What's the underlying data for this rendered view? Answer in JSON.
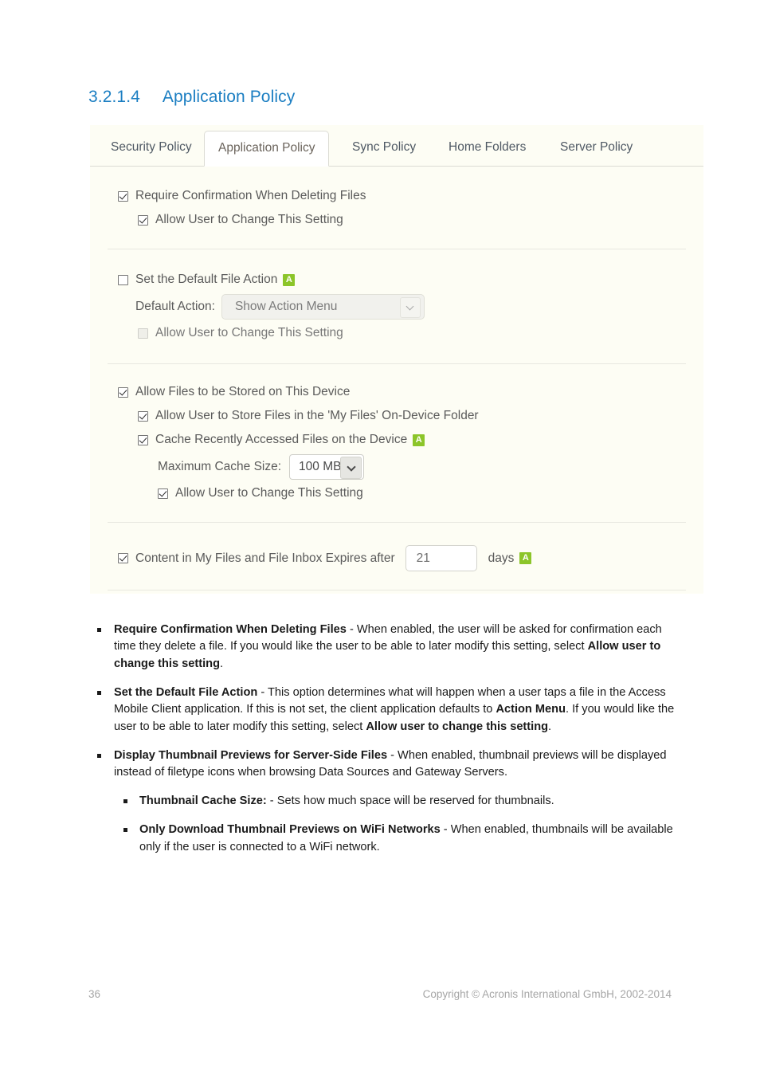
{
  "heading": {
    "number": "3.2.1.4",
    "title": "Application Policy"
  },
  "panel": {
    "tabs": [
      {
        "label": "Security Policy",
        "active": false
      },
      {
        "label": "Application Policy",
        "active": true
      },
      {
        "label": "Sync Policy",
        "active": false
      },
      {
        "label": "Home Folders",
        "active": false
      },
      {
        "label": "Server Policy",
        "active": false
      }
    ],
    "group1": {
      "require_confirmation_label": "Require Confirmation When Deleting Files",
      "require_confirmation_checked": true,
      "allow_user_change_label": "Allow User to Change This Setting",
      "allow_user_change_checked": true
    },
    "group2": {
      "set_default_action_label": "Set the Default File Action",
      "set_default_action_checked": false,
      "badge": "A",
      "default_action_field_label": "Default Action:",
      "default_action_value": "Show Action Menu",
      "allow_user_change_label": "Allow User to Change This Setting",
      "allow_user_change_checked": false
    },
    "group3": {
      "allow_files_stored_label": "Allow Files to be Stored on This Device",
      "allow_files_stored_checked": true,
      "allow_my_files_label": "Allow User to Store Files in the 'My Files' On-Device Folder",
      "allow_my_files_checked": true,
      "cache_recent_label": "Cache Recently Accessed Files on the Device",
      "cache_recent_checked": true,
      "badge": "A",
      "max_cache_label": "Maximum Cache Size:",
      "max_cache_value": "100 MB",
      "allow_user_change_label": "Allow User to Change This Setting",
      "allow_user_change_checked": true
    },
    "group4": {
      "expires_label": "Content in My Files and File Inbox Expires after",
      "expires_checked": true,
      "expires_value": "21",
      "days_label": "days",
      "badge": "A"
    },
    "colors": {
      "badge_green": "#8cc529",
      "panel_background": "#fdfdf4",
      "heading_blue": "#1b7ec2"
    }
  },
  "bullets": [
    {
      "level": 1,
      "parts": [
        {
          "b": true,
          "t": "Require Confirmation When Deleting Files"
        },
        {
          "b": false,
          "t": " - When enabled, the user will be asked for confirmation each time they delete a file. If you would like the user to be able to later modify this setting, select "
        },
        {
          "b": true,
          "t": "Allow user to change this setting"
        },
        {
          "b": false,
          "t": "."
        }
      ]
    },
    {
      "level": 1,
      "parts": [
        {
          "b": true,
          "t": "Set the Default File Action"
        },
        {
          "b": false,
          "t": " - This option determines what will happen when a user taps a file in the Access Mobile Client application. If this is not set, the client application defaults to "
        },
        {
          "b": true,
          "t": "Action Menu"
        },
        {
          "b": false,
          "t": ". If you would like the user to be able to later modify this setting, select "
        },
        {
          "b": true,
          "t": "Allow user to change this setting"
        },
        {
          "b": false,
          "t": "."
        }
      ]
    },
    {
      "level": 1,
      "parts": [
        {
          "b": true,
          "t": "Display Thumbnail Previews for Server-Side Files"
        },
        {
          "b": false,
          "t": " - When enabled, thumbnail previews will be displayed instead of filetype icons when browsing Data Sources and Gateway Servers."
        }
      ]
    },
    {
      "level": 2,
      "parts": [
        {
          "b": true,
          "t": "Thumbnail Cache Size:"
        },
        {
          "b": false,
          "t": " - Sets how much space will be reserved for thumbnails."
        }
      ]
    },
    {
      "level": 2,
      "parts": [
        {
          "b": true,
          "t": "Only Download Thumbnail Previews on WiFi Networks"
        },
        {
          "b": false,
          "t": " - When enabled, thumbnails will be available only if the user is connected to a WiFi network."
        }
      ]
    }
  ],
  "footer": {
    "page_number": "36",
    "copyright": "Copyright © Acronis International GmbH, 2002-2014"
  }
}
